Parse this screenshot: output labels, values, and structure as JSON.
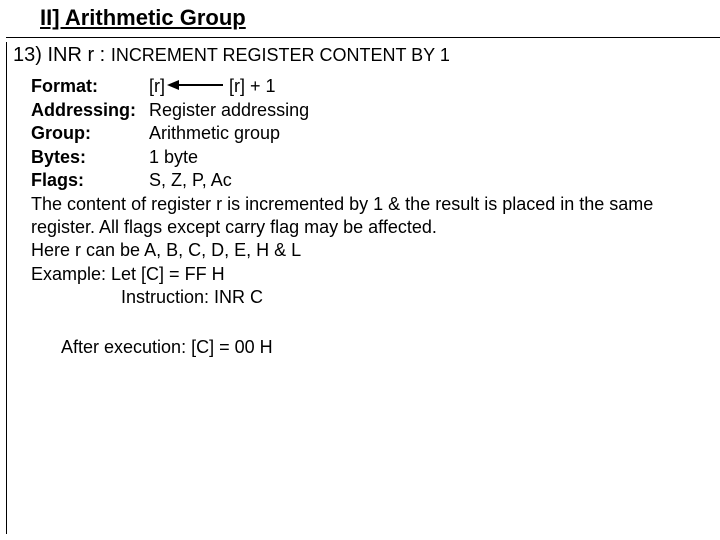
{
  "section_title": "II] Arithmetic Group",
  "item_number": "13)",
  "instr_name": "INR r :",
  "instr_desc": "INCREMENT REGISTER CONTENT BY 1",
  "labels": {
    "format": "Format:",
    "addressing": "Addressing:",
    "group": "Group:",
    "bytes": "Bytes:",
    "flags": "Flags:"
  },
  "format": {
    "lhs": "[r]",
    "rhs": "[r] + 1"
  },
  "addressing": "Register addressing",
  "group": "Arithmetic group",
  "bytes": "1 byte",
  "flags": "S, Z, P, Ac",
  "description": "The content of register r is incremented by 1 & the result is placed in the same register. All flags except carry flag may be affected.",
  "registers_note": "Here r can be A, B, C, D, E, H & L",
  "example_label": "Example: Let [C] = FF H",
  "example_instruction": "Instruction: INR C",
  "after_execution": "After execution: [C] = 00 H"
}
